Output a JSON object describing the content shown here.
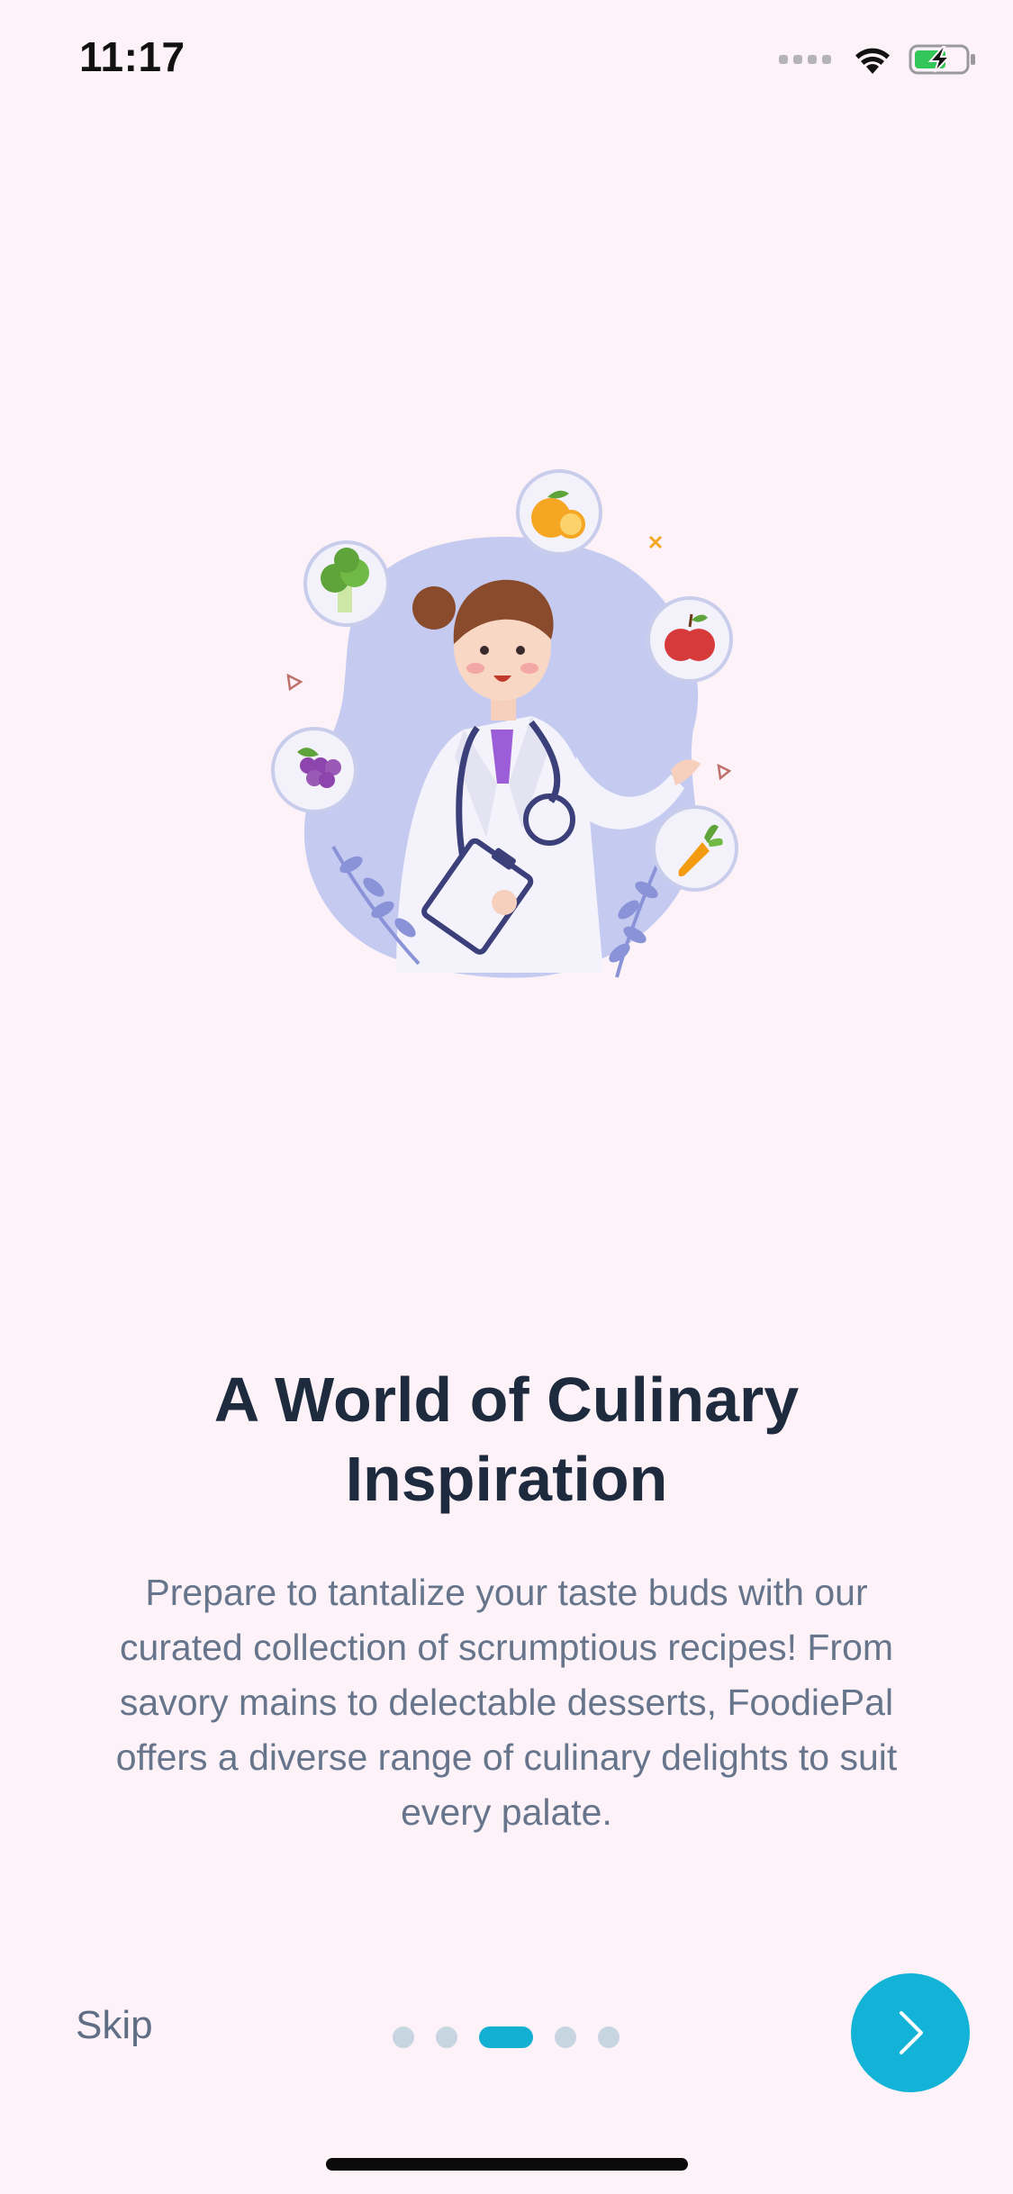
{
  "status_bar": {
    "time": "11:17",
    "icons": [
      "cellular-signal-icon",
      "wifi-icon",
      "battery-charging-icon"
    ]
  },
  "onboarding": {
    "illustration": "doctor-with-fruits-illustration",
    "title": "A World of Culinary Inspiration",
    "description": "Prepare to tantalize your taste buds with our curated collection of scrumptious recipes! From savory mains to delectable desserts, FoodiePal offers a diverse range of culinary delights to suit every palate."
  },
  "navigation": {
    "skip_label": "Skip",
    "page_count": 5,
    "current_page": 3,
    "next_icon": "chevron-right-icon"
  },
  "colors": {
    "background": "#fcf2f7",
    "accent": "#12b3d6",
    "title": "#1e2a3e",
    "body_text": "#66758c",
    "inactive_dot": "#c7d5e0"
  }
}
